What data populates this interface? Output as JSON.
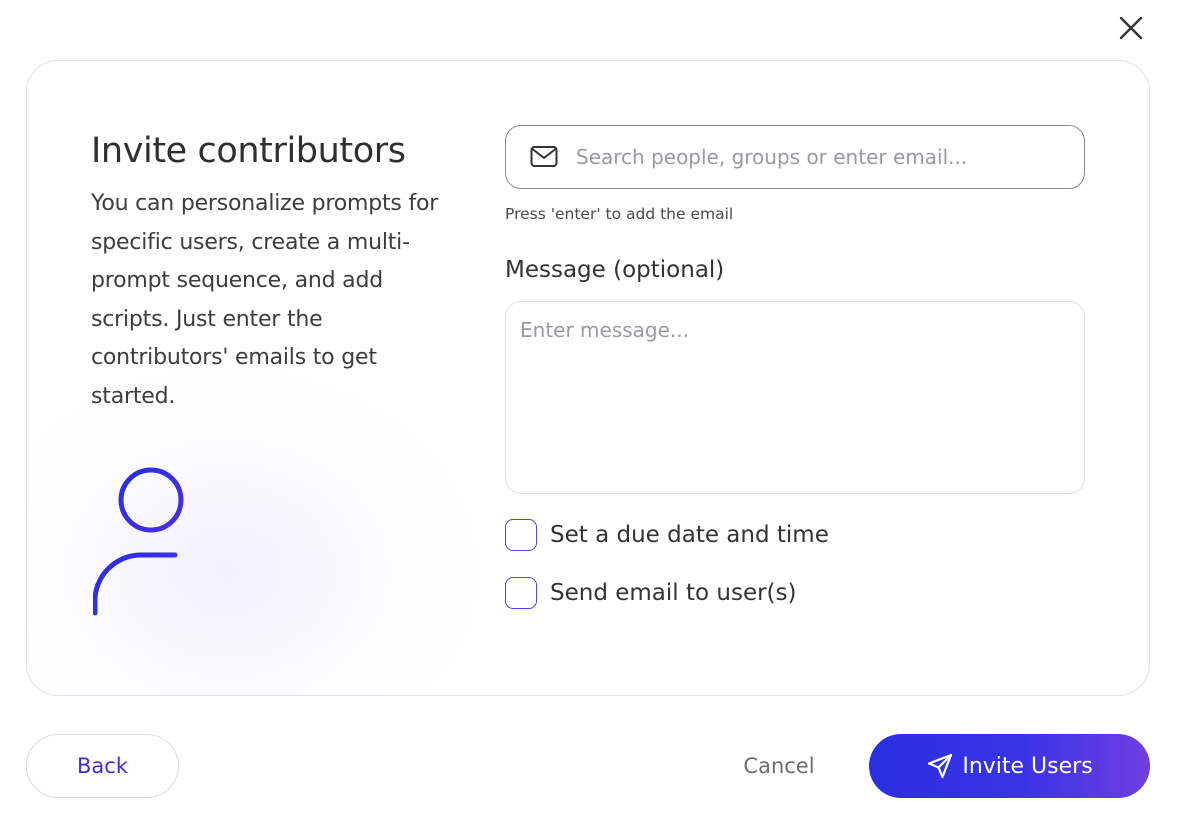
{
  "dialog": {
    "title": "Invite contributors",
    "description": "You can personalize prompts for specific users, create a multi-prompt sequence, and add scripts. Just enter the contributors' emails to get started.",
    "illustration_icon": "add-user-icon"
  },
  "search": {
    "icon": "mail-icon",
    "value": "",
    "placeholder": "Search people, groups or enter email...",
    "hint": "Press 'enter' to add the email"
  },
  "message": {
    "label": "Message (optional)",
    "value": "",
    "placeholder": "Enter message..."
  },
  "options": [
    {
      "label": "Set a due date and time",
      "checked": false
    },
    {
      "label": "Send email to user(s)",
      "checked": false
    }
  ],
  "footer": {
    "back_label": "Back",
    "cancel_label": "Cancel",
    "invite_label": "Invite Users",
    "invite_icon": "send-icon"
  },
  "colors": {
    "accent": "#3a33e6",
    "accent_gradient_end": "#6f3fe0",
    "checkbox_border": "#5a3fd8"
  }
}
